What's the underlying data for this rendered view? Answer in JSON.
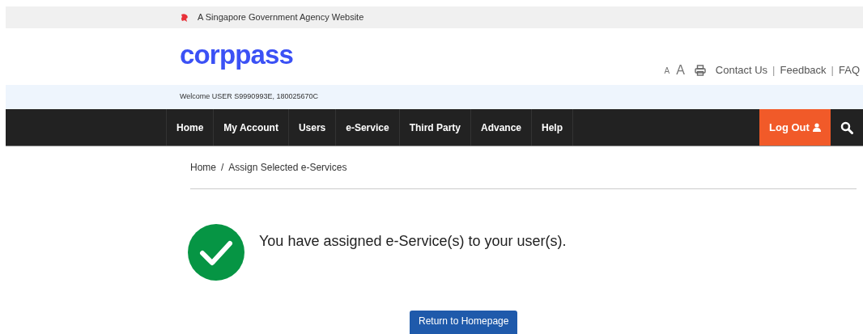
{
  "masthead": {
    "text": "A Singapore Government Agency Website"
  },
  "logo": "corppass",
  "utility": {
    "font_small": "A",
    "font_large": "A",
    "links": [
      "Contact Us",
      "Feedback",
      "FAQ"
    ],
    "separator": "|"
  },
  "welcome": "Welcome USER S9990993E, 180025670C",
  "nav": {
    "items": [
      "Home",
      "My Account",
      "Users",
      "e-Service",
      "Third Party",
      "Advance",
      "Help"
    ],
    "logout": "Log Out"
  },
  "breadcrumb": {
    "items": [
      "Home",
      "Assign Selected e-Services"
    ],
    "separator": "/"
  },
  "message": "You have assigned e-Service(s) to your user(s).",
  "button": "Return to Homepage"
}
